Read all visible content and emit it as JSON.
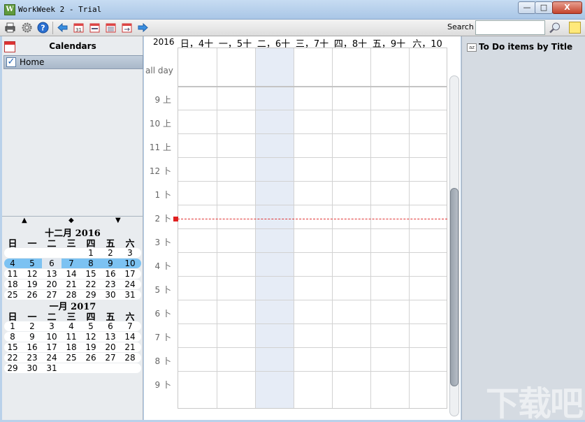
{
  "window": {
    "title": "WorkWeek 2 - Trial",
    "logo": "W",
    "min_label": "—",
    "max_label": "□",
    "close_label": "X"
  },
  "toolbar": {
    "icons": [
      "print-icon",
      "settings-icon",
      "help-icon",
      "back-arrow-icon",
      "day-view-icon",
      "week-view-icon",
      "month-view-icon",
      "list-view-icon",
      "forward-arrow-icon"
    ],
    "search_label": "Search",
    "search_value": "",
    "search_placeholder": ""
  },
  "calendars": {
    "title": "Calendars",
    "items": [
      {
        "label": "Home",
        "checked": true,
        "check_glyph": "✓"
      }
    ]
  },
  "mini_calendar": {
    "nav": {
      "prev": "▲",
      "today": "◆",
      "next": "▼"
    },
    "weekdays": [
      "日",
      "一",
      "二",
      "三",
      "四",
      "五",
      "六"
    ],
    "months": [
      {
        "title": "十二月 2016",
        "weeks": [
          [
            "",
            "",
            "",
            "",
            "1",
            "2",
            "3"
          ],
          [
            "4",
            "5",
            "6",
            "7",
            "8",
            "9",
            "10"
          ],
          [
            "11",
            "12",
            "13",
            "14",
            "15",
            "16",
            "17"
          ],
          [
            "18",
            "19",
            "20",
            "21",
            "22",
            "23",
            "24"
          ],
          [
            "25",
            "26",
            "27",
            "28",
            "29",
            "30",
            "31"
          ]
        ],
        "selected_week_index": 1,
        "today_cell": [
          1,
          2
        ]
      },
      {
        "title": "一月 2017",
        "weeks": [
          [
            "1",
            "2",
            "3",
            "4",
            "5",
            "6",
            "7"
          ],
          [
            "8",
            "9",
            "10",
            "11",
            "12",
            "13",
            "14"
          ],
          [
            "15",
            "16",
            "17",
            "18",
            "19",
            "20",
            "21"
          ],
          [
            "22",
            "23",
            "24",
            "25",
            "26",
            "27",
            "28"
          ],
          [
            "29",
            "30",
            "31",
            "",
            "",
            "",
            ""
          ]
        ],
        "selected_week_index": -1,
        "today_cell": null
      }
    ]
  },
  "week_view": {
    "year": "2016",
    "day_headers": [
      "日，4十",
      "一，5十",
      "二，6十",
      "三，7十",
      "四，8十",
      "五，9十",
      "六，10"
    ],
    "selected_day_index": 2,
    "allday_label": "all day",
    "time_labels": [
      "9 上",
      "10 上",
      "11 上",
      "12 卜",
      "1 卜",
      "2 卜",
      "3 卜",
      "4 卜",
      "5 卜",
      "6 卜",
      "7 卜",
      "8 卜",
      "9 卜"
    ],
    "current_time_slot": 5
  },
  "todo": {
    "icon_text": "az",
    "title": "To Do items  by Title"
  },
  "colors": {
    "selected_week": "#7cc2f2",
    "selected_day": "#e6ecf6",
    "now_line": "#e03030"
  },
  "watermark": "下载吧"
}
